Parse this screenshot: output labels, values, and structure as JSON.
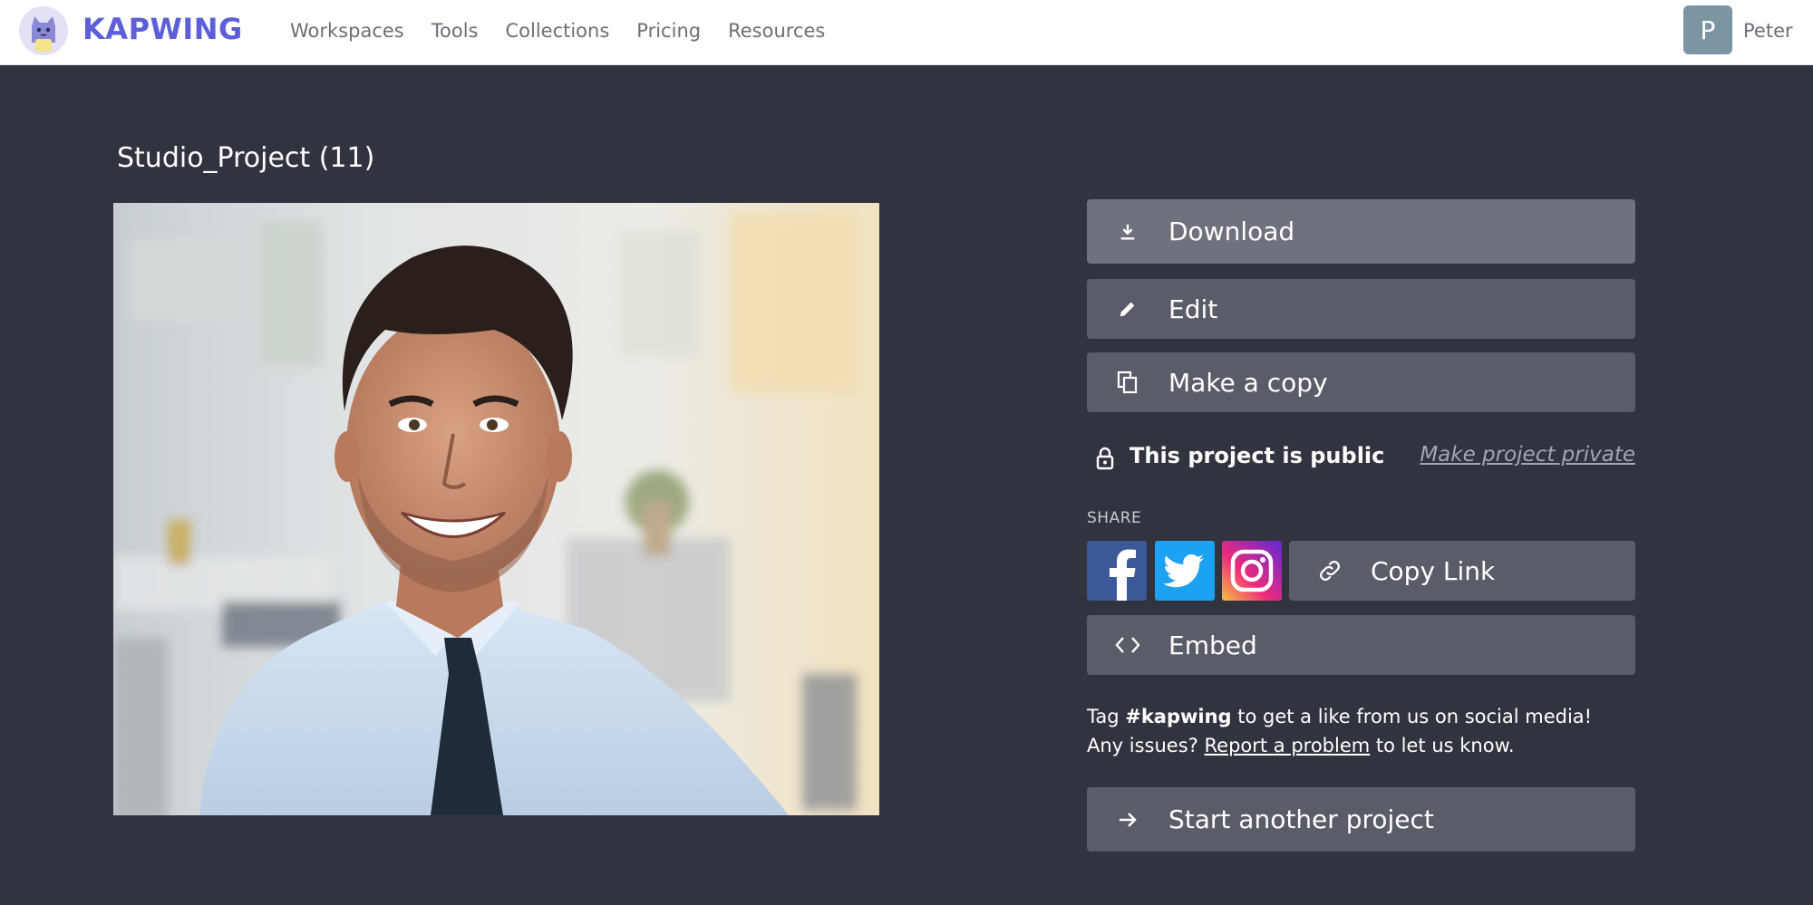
{
  "brand": {
    "name": "KAPWING"
  },
  "nav": {
    "items": [
      "Workspaces",
      "Tools",
      "Collections",
      "Pricing",
      "Resources"
    ]
  },
  "user": {
    "initial": "P",
    "name": "Peter"
  },
  "project": {
    "title": "Studio_Project (11)"
  },
  "actions": {
    "download": "Download",
    "edit": "Edit",
    "copy": "Make a copy"
  },
  "privacy": {
    "status": "This project is public",
    "toggle_link": "Make project private"
  },
  "share": {
    "label": "SHARE",
    "networks": [
      "facebook",
      "twitter",
      "instagram"
    ],
    "copy_link": "Copy Link",
    "embed": "Embed"
  },
  "tagline": {
    "prefix": "Tag ",
    "hashtag": "#kapwing",
    "middle": " to get a like from us on social media! Any issues? ",
    "report_link": "Report a problem",
    "suffix": " to let us know."
  },
  "start_another": "Start another project",
  "colors": {
    "brand": "#5d5fd8",
    "background": "#31343f",
    "button": "#5a5d68",
    "button_primary": "#6f727c",
    "facebook": "#3b5998",
    "twitter": "#1da1f2"
  }
}
